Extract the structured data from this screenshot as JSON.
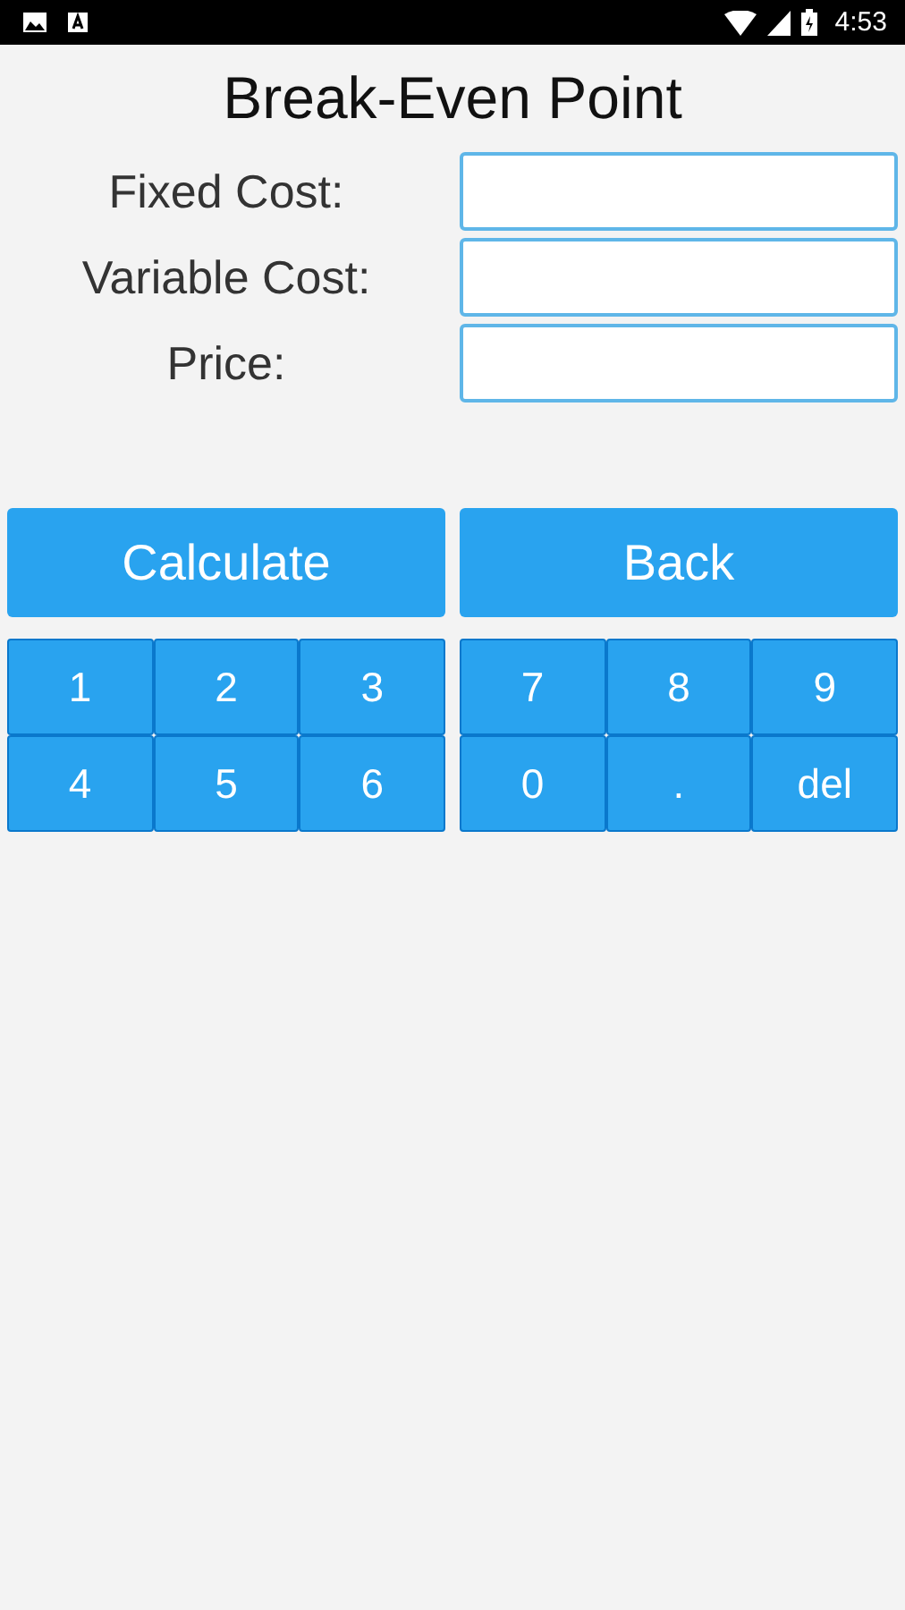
{
  "status_bar": {
    "time": "4:53"
  },
  "title": "Break-Even Point",
  "fields": [
    {
      "label": "Fixed Cost:"
    },
    {
      "label": "Variable Cost:"
    },
    {
      "label": "Price:"
    }
  ],
  "buttons": [
    "Calculate",
    "Back"
  ],
  "keypads": [
    {
      "keys": [
        "1",
        "2",
        "3",
        "4",
        "5",
        "6"
      ]
    },
    {
      "keys": [
        "7",
        "8",
        "9",
        "0",
        ".",
        "del"
      ]
    }
  ]
}
